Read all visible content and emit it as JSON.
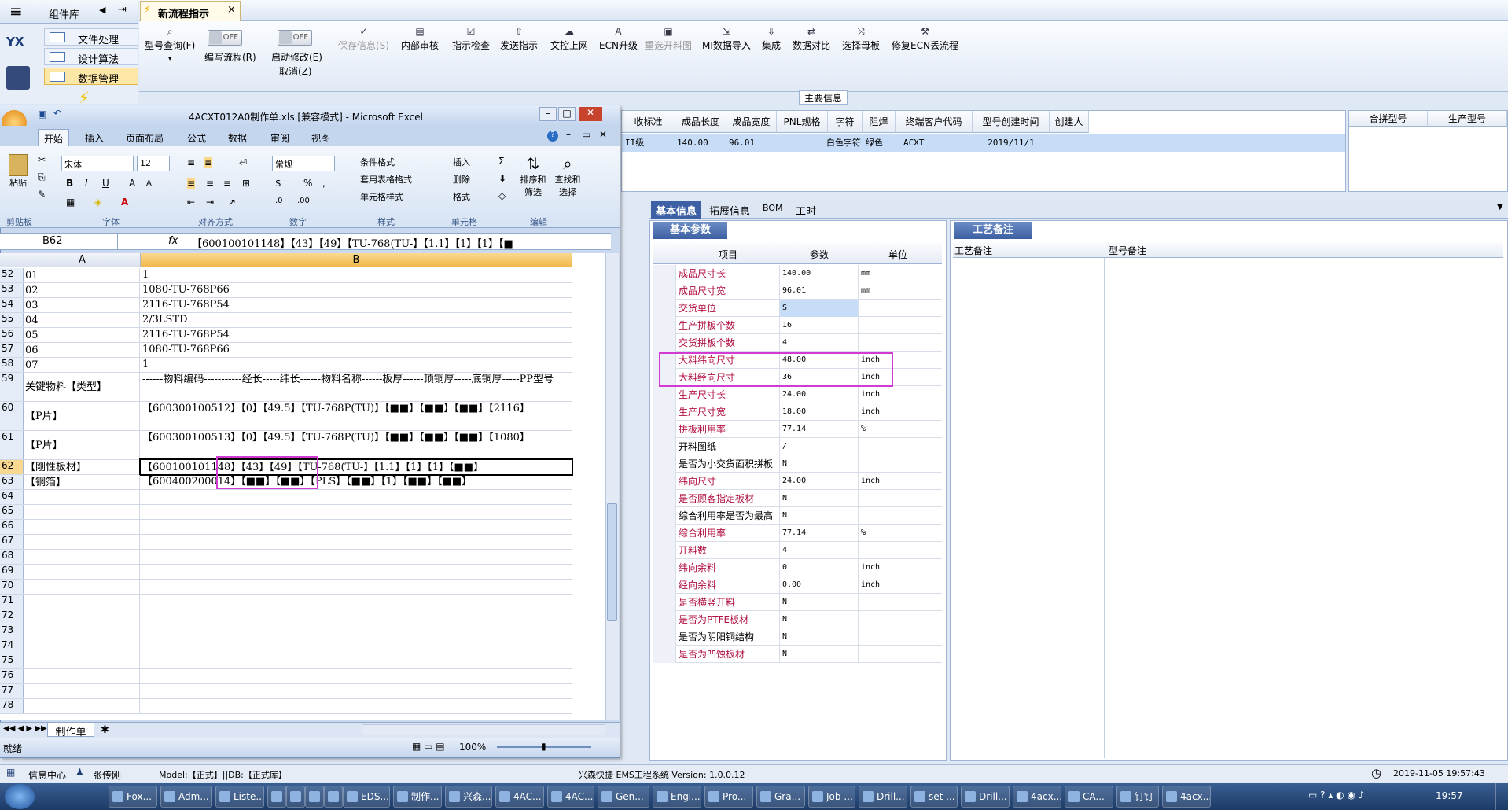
{
  "nav": {
    "title": "组件库",
    "items": [
      "文件处理",
      "设计算法",
      "数据管理"
    ],
    "logo": "YX"
  },
  "doc_tab": {
    "label": "新流程指示",
    "close": "×"
  },
  "toolbar": {
    "buttons": [
      {
        "label": "型号查询(F)",
        "icon": "search-icon",
        "sub": "▾"
      },
      {
        "label": "编写流程(R)",
        "toggle": "OFF"
      },
      {
        "label": "启动修改(E)",
        "sub": "取消(Z)",
        "toggle": "OFF"
      },
      {
        "label": "保存信息(S)",
        "icon": "check-icon"
      },
      {
        "label": "内部审核",
        "icon": "print-icon"
      },
      {
        "label": "指示检查",
        "icon": "check-icon"
      },
      {
        "label": "发送指示",
        "icon": "upload-icon"
      },
      {
        "label": "文控上网",
        "icon": "cloud-icon"
      },
      {
        "label": "ECN升级",
        "icon": "ecn-icon"
      },
      {
        "label": "重选开料图",
        "icon": "image-icon"
      },
      {
        "label": "MI数据导入",
        "icon": "import-icon"
      },
      {
        "label": "集成",
        "icon": "download-icon"
      },
      {
        "label": "数据对比",
        "icon": "compare-icon"
      },
      {
        "label": "选择母板",
        "icon": "shuffle-icon"
      },
      {
        "label": "修复ECN丢流程",
        "icon": "wrench-icon"
      }
    ]
  },
  "main_info": {
    "title": "主要信息",
    "columns": [
      "收标准",
      "成品长度",
      "成品宽度",
      "PNL规格",
      "字符",
      "阻焊",
      "终端客户代码",
      "型号创建时间",
      "创建人"
    ],
    "row": [
      "II级",
      "140.00",
      "96.01",
      "",
      "白色字符",
      "绿色",
      "ACXT",
      "2019/11/1",
      ""
    ],
    "side_columns": [
      "合拼型号",
      "生产型号"
    ]
  },
  "detail_tabs": [
    "基本信息",
    "拓展信息",
    "BOM",
    "工时"
  ],
  "basic_params": {
    "title": "基本参数",
    "headers": [
      "项目",
      "参数",
      "单位"
    ],
    "rows": [
      [
        "成品尺寸长",
        "140.00",
        "mm"
      ],
      [
        "成品尺寸宽",
        "96.01",
        "mm"
      ],
      [
        "交货单位",
        "S",
        ""
      ],
      [
        "生产拼板个数",
        "16",
        ""
      ],
      [
        "交货拼板个数",
        "4",
        ""
      ],
      [
        "大料纬向尺寸",
        "48.00",
        "inch"
      ],
      [
        "大料经向尺寸",
        "36",
        "inch"
      ],
      [
        "生产尺寸长",
        "24.00",
        "inch"
      ],
      [
        "生产尺寸宽",
        "18.00",
        "inch"
      ],
      [
        "拼板利用率",
        "77.14",
        "%"
      ],
      [
        "开料图纸",
        "/",
        ""
      ],
      [
        "是否为小交货面积拼板",
        "N",
        ""
      ],
      [
        "纬向尺寸",
        "24.00",
        "inch"
      ],
      [
        "是否顾客指定板材",
        "N",
        ""
      ],
      [
        "综合利用率是否为最高",
        "N",
        ""
      ],
      [
        "综合利用率",
        "77.14",
        "%"
      ],
      [
        "开料数",
        "4",
        ""
      ],
      [
        "纬向余料",
        "0",
        "inch"
      ],
      [
        "经向余料",
        "0.00",
        "inch"
      ],
      [
        "是否横竖开料",
        "N",
        ""
      ],
      [
        "是否为PTFE板材",
        "N",
        ""
      ],
      [
        "是否为阴阳铜结构",
        "N",
        ""
      ],
      [
        "是否为凹蚀板材",
        "N",
        ""
      ]
    ],
    "red_rows": [
      0,
      1,
      2,
      3,
      4,
      5,
      6,
      7,
      8,
      9,
      12,
      13,
      15,
      16,
      17,
      18,
      19,
      20,
      22
    ]
  },
  "craft": {
    "title": "工艺备注",
    "col1": "工艺备注",
    "col2": "型号备注"
  },
  "excel": {
    "title": "4ACXT012A0制作单.xls [兼容模式] - Microsoft Excel",
    "tabs": [
      "开始",
      "插入",
      "页面布局",
      "公式",
      "数据",
      "审阅",
      "视图"
    ],
    "font": "宋体",
    "size": "12",
    "number_format": "常规",
    "groups": [
      "剪贴板",
      "字体",
      "对齐方式",
      "数字",
      "样式",
      "单元格",
      "编辑"
    ],
    "style_items": [
      "条件格式",
      "套用表格格式",
      "单元格样式"
    ],
    "cell_items": [
      "插入",
      "删除",
      "格式"
    ],
    "edit_items": [
      "排序和筛选",
      "查找和选择"
    ],
    "paste": "粘贴",
    "name_box": "B62",
    "formula": "【600100101148】【43】【49】【TU-768(TU-】【1.1】【1】【1】【■",
    "col_headers": [
      "A",
      "B"
    ],
    "rows": [
      {
        "n": "52",
        "a": "01",
        "b": "1"
      },
      {
        "n": "53",
        "a": "02",
        "b": "1080-TU-768P66"
      },
      {
        "n": "54",
        "a": "03",
        "b": "2116-TU-768P54"
      },
      {
        "n": "55",
        "a": "04",
        "b": "2/3LSTD"
      },
      {
        "n": "56",
        "a": "05",
        "b": "2116-TU-768P54"
      },
      {
        "n": "57",
        "a": "06",
        "b": "1080-TU-768P66"
      },
      {
        "n": "58",
        "a": "07",
        "b": "1"
      },
      {
        "n": "59",
        "a": "关键物料【类型】",
        "b": "------物料编码-----------经长-----纬长------物料名称------板厚------顶铜厚-----底铜厚-----PP型号"
      },
      {
        "n": "60",
        "a": "【P片】",
        "b": "【600300100512】【0】【49.5】【TU-768P(TU)】【■■】【■■】【■■】【2116】"
      },
      {
        "n": "61",
        "a": "【P片】",
        "b": "【600300100513】【0】【49.5】【TU-768P(TU)】【■■】【■■】【■■】【1080】"
      },
      {
        "n": "62",
        "a": "【刚性板材】",
        "b": "【600100101148】【43】【49】【TU-768(TU-】【1.1】【1】【1】【■■】"
      },
      {
        "n": "63",
        "a": "【铜箔】",
        "b": "【600400200014】【■■】【■■】【PLS】【■■】【1】【■■】【■■】"
      },
      {
        "n": "64",
        "a": "",
        "b": ""
      },
      {
        "n": "65",
        "a": "",
        "b": ""
      },
      {
        "n": "66",
        "a": "",
        "b": ""
      },
      {
        "n": "67",
        "a": "",
        "b": ""
      },
      {
        "n": "68",
        "a": "",
        "b": ""
      },
      {
        "n": "69",
        "a": "",
        "b": ""
      },
      {
        "n": "70",
        "a": "",
        "b": ""
      },
      {
        "n": "71",
        "a": "",
        "b": ""
      },
      {
        "n": "72",
        "a": "",
        "b": ""
      },
      {
        "n": "73",
        "a": "",
        "b": ""
      },
      {
        "n": "74",
        "a": "",
        "b": ""
      },
      {
        "n": "75",
        "a": "",
        "b": ""
      },
      {
        "n": "76",
        "a": "",
        "b": ""
      },
      {
        "n": "77",
        "a": "",
        "b": ""
      },
      {
        "n": "78",
        "a": "",
        "b": ""
      }
    ],
    "sheet_tab": "制作单",
    "status": "就绪",
    "zoom": "100%"
  },
  "statusbar": {
    "info_center": "信息中心",
    "user": "张传刚",
    "model": "Model:【正式】||DB:【正式库】",
    "app": "兴森快捷 EMS工程系统 Version: 1.0.0.12",
    "datetime": "2019-11-05 19:57:43"
  },
  "taskbar": {
    "items": [
      "Fox...",
      "Adm...",
      "Liste...",
      "",
      "",
      "",
      "",
      "EDS...",
      "制作...",
      "兴森...",
      "4AC...",
      "4AC...",
      "Gen...",
      "Engi...",
      "Pro...",
      "Gra...",
      "Job ...",
      "Drill...",
      "set ...",
      "Drill...",
      "4acx...",
      "CA...",
      "钉钉",
      "4acx..."
    ],
    "clock": "19:57"
  },
  "colors": {
    "highlight": "#d23bd2",
    "label_red": "#b01040",
    "selection": "#c6dcf7"
  }
}
